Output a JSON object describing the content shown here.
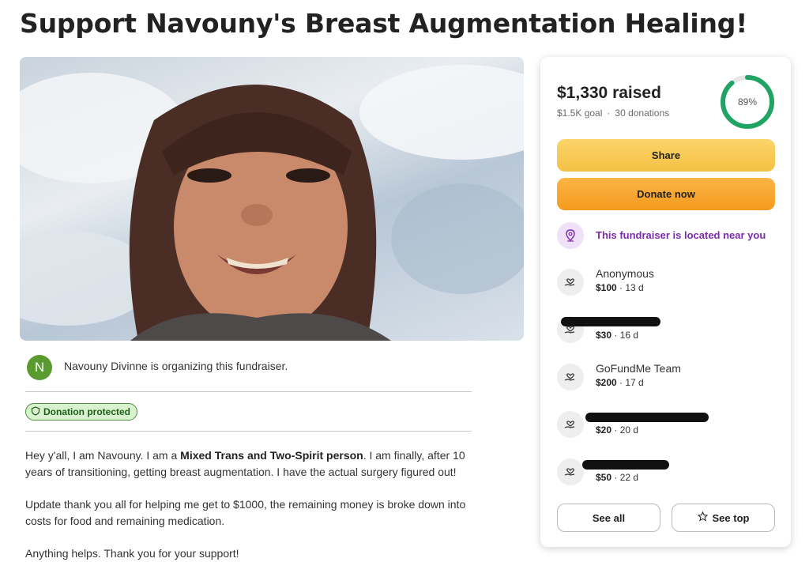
{
  "page": {
    "title": "Support Navouny's Breast Augmentation Healing!"
  },
  "organizer": {
    "initial": "N",
    "text": "Navouny Divinne is organizing this fundraiser."
  },
  "badge": {
    "label": "Donation protected",
    "icon": "shield-icon"
  },
  "story": {
    "p1_prefix": "Hey y'all, I am Navouny. I am a ",
    "p1_bold": "Mixed Trans and Two-Spirit person",
    "p1_suffix": ". I am finally, after 10 years of transitioning, getting breast augmentation. I have the actual surgery figured out!",
    "p2": "Update thank you all for helping me get to $1000, the remaining money is broke down into costs for food and remaining medication.",
    "p3": "Anything helps. Thank you for your support!"
  },
  "card": {
    "raised": "$1,330 raised",
    "goal": "$1.5K goal",
    "separator": "·",
    "donations_count": "30 donations",
    "progress_label": "89%",
    "progress_fraction": 0.89,
    "share_label": "Share",
    "donate_label": "Donate now",
    "location_text": "This fundraiser is located near you",
    "see_all_label": "See all",
    "see_top_label": "See top"
  },
  "donations": [
    {
      "name": "Anonymous",
      "amount": "$100",
      "age": "· 13 d",
      "redacted": false
    },
    {
      "name": "",
      "amount": "$30",
      "age": "· 16 d",
      "redacted": true
    },
    {
      "name": "GoFundMe Team",
      "amount": "$200",
      "age": "· 17 d",
      "redacted": false
    },
    {
      "name": "",
      "amount": "$20",
      "age": "· 20 d",
      "redacted": true
    },
    {
      "name": "",
      "amount": "$50",
      "age": "· 22 d",
      "redacted": true
    }
  ],
  "colors": {
    "progress": "#1fa463",
    "share": "#f4c143",
    "donate": "#f39a1e",
    "location_accent": "#7a2bb0",
    "avatar": "#5a9b2f"
  }
}
